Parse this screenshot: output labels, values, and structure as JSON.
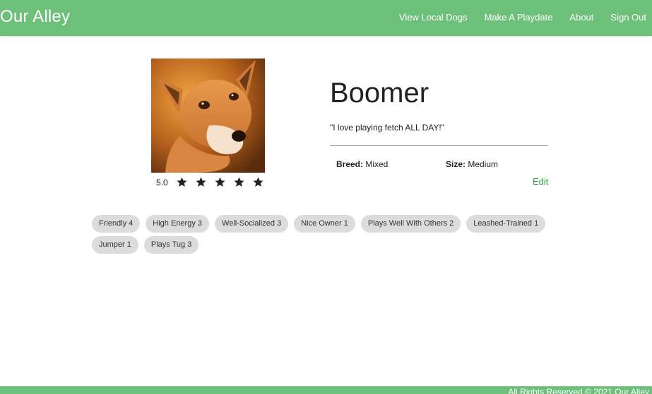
{
  "navbar": {
    "brand": "Our Alley",
    "links": [
      {
        "label": "View Local Dogs"
      },
      {
        "label": "Make A Playdate"
      },
      {
        "label": "About"
      },
      {
        "label": "Sign Out"
      }
    ],
    "color": "#6cc07a"
  },
  "profile": {
    "name": "Boomer",
    "quote": "\"I love playing fetch ALL DAY!\"",
    "rating": {
      "value_text": "5.0",
      "stars": 5,
      "max": 5
    },
    "details": {
      "breed_label": "Breed:",
      "breed_value": " Mixed",
      "size_label": "Size:",
      "size_value": " Medium"
    },
    "edit_label": "Edit",
    "accent": "#2ea33f"
  },
  "tags": [
    [
      {
        "label": "Friendly 4"
      },
      {
        "label": "High Energy 3"
      },
      {
        "label": "Well-Socialized 3"
      },
      {
        "label": "Nice Owner 1"
      },
      {
        "label": "Plays Well With Others 2"
      },
      {
        "label": "Leashed-Trained 1"
      }
    ],
    [
      {
        "label": "Jumper 1"
      },
      {
        "label": "Plays Tug 3"
      }
    ]
  ],
  "footer": {
    "text": "All Rights Reserved  © 2021 Our Alley"
  }
}
